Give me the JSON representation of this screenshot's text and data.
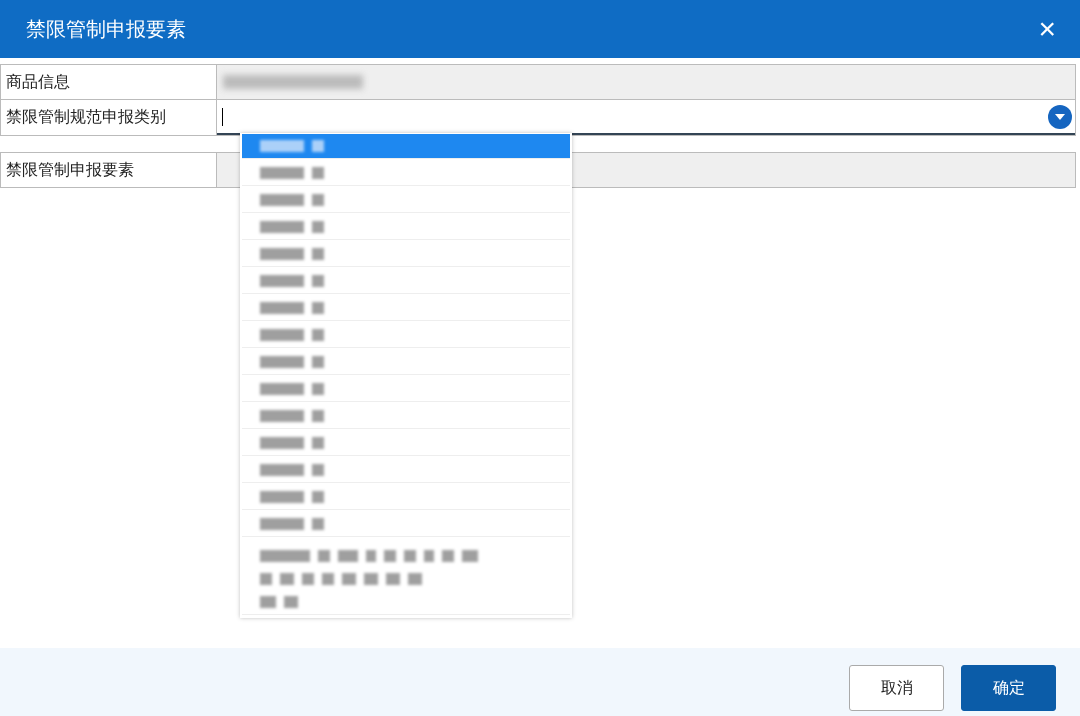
{
  "window": {
    "title": "禁限管制申报要素",
    "close": "×"
  },
  "fields": [
    {
      "label": "商品信息",
      "kind": "readonly-blurred"
    },
    {
      "label": "禁限管制规范申报类别",
      "kind": "combo",
      "focused": true
    },
    {
      "label": "禁限管制申报要素",
      "kind": "readonly"
    }
  ],
  "dropdown": {
    "options": [
      {
        "kind": "short",
        "selected": true
      },
      {
        "kind": "short",
        "selected": false
      },
      {
        "kind": "short",
        "selected": false
      },
      {
        "kind": "short",
        "selected": false
      },
      {
        "kind": "short",
        "selected": false
      },
      {
        "kind": "short",
        "selected": false
      },
      {
        "kind": "short",
        "selected": false
      },
      {
        "kind": "short",
        "selected": false
      },
      {
        "kind": "short",
        "selected": false
      },
      {
        "kind": "short",
        "selected": false
      },
      {
        "kind": "short",
        "selected": false
      },
      {
        "kind": "short",
        "selected": false
      },
      {
        "kind": "short",
        "selected": false
      },
      {
        "kind": "short",
        "selected": false
      },
      {
        "kind": "short",
        "selected": false
      },
      {
        "kind": "long",
        "selected": false
      }
    ]
  },
  "buttons": [
    {
      "label": "取消",
      "kind": "secondary"
    },
    {
      "label": "确定",
      "kind": "primary"
    }
  ]
}
